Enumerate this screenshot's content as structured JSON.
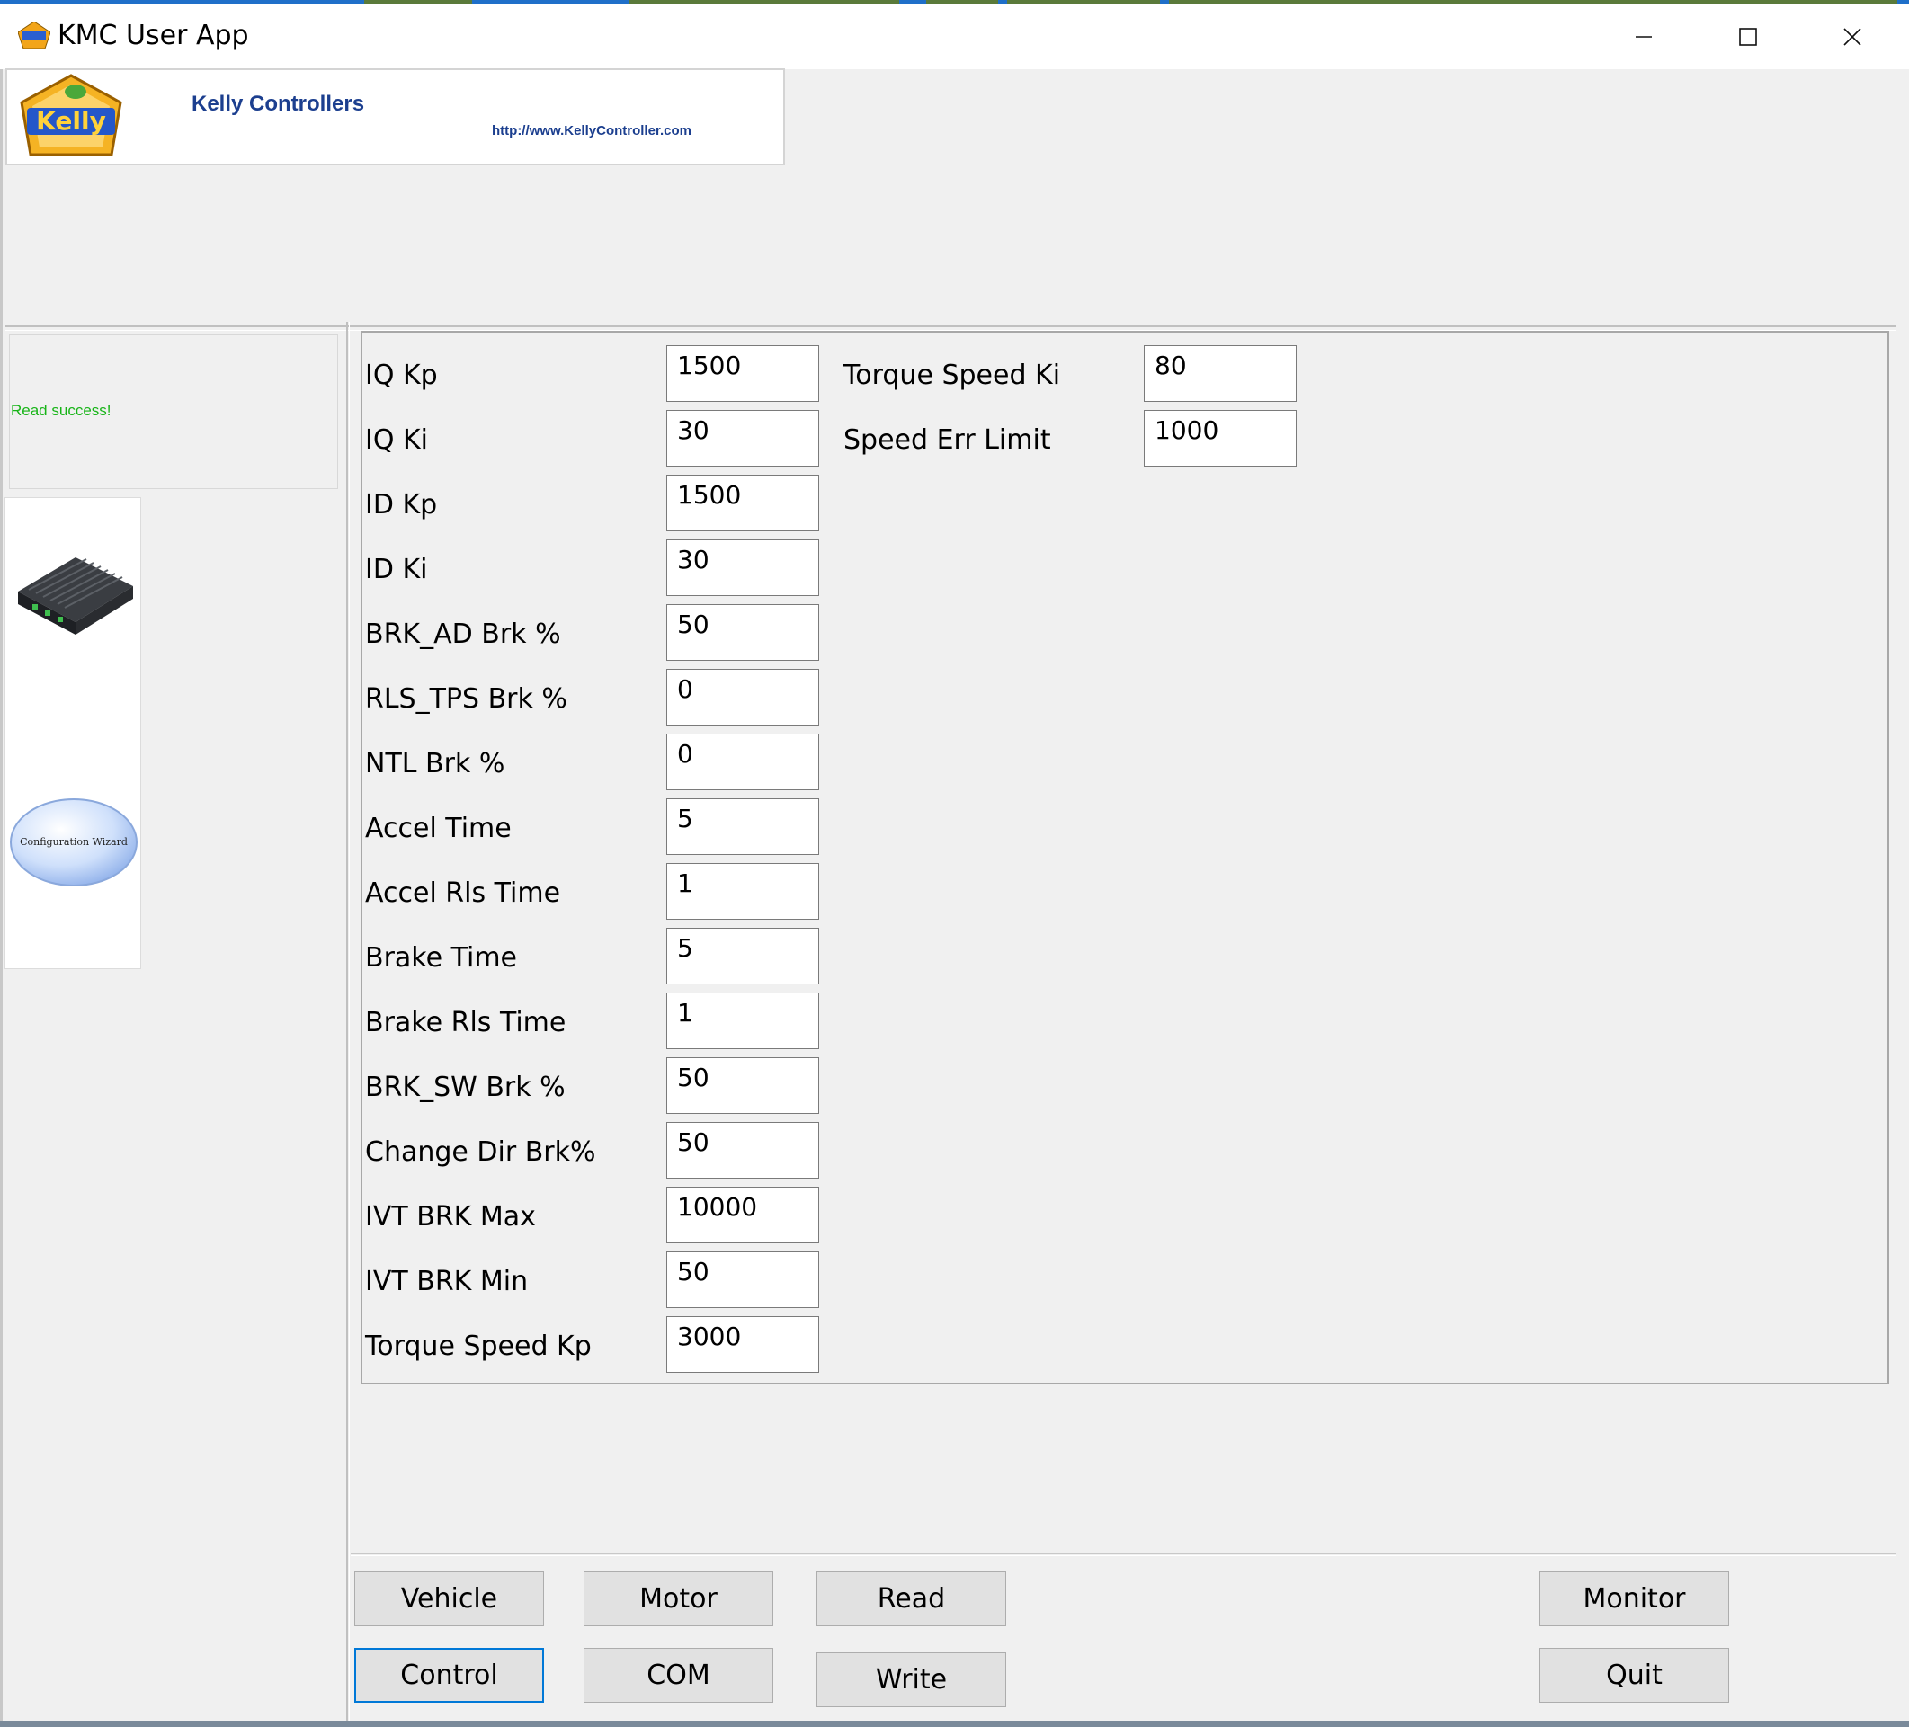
{
  "window": {
    "title": "KMC User App",
    "controls": {
      "minimize": "—",
      "maximize": "☐",
      "close": "✕"
    }
  },
  "banner": {
    "brand": "Kelly Controllers",
    "url": "http://www.KellyController.com",
    "logo_text": "Kelly"
  },
  "status": {
    "message": "Read success!",
    "color": "#18b418"
  },
  "wizard": {
    "label": "Configuration Wizard"
  },
  "params_left": [
    {
      "label": "IQ Kp",
      "value": "1500"
    },
    {
      "label": "IQ Ki",
      "value": "30"
    },
    {
      "label": "ID Kp",
      "value": "1500"
    },
    {
      "label": "ID Ki",
      "value": "30"
    },
    {
      "label": "BRK_AD Brk %",
      "value": "50"
    },
    {
      "label": "RLS_TPS Brk %",
      "value": "0"
    },
    {
      "label": "NTL Brk %",
      "value": "0"
    },
    {
      "label": "Accel Time",
      "value": "5"
    },
    {
      "label": "Accel Rls Time",
      "value": "1"
    },
    {
      "label": "Brake Time",
      "value": "5"
    },
    {
      "label": "Brake Rls Time",
      "value": "1"
    },
    {
      "label": "BRK_SW Brk %",
      "value": "50"
    },
    {
      "label": "Change Dir Brk%",
      "value": "50"
    },
    {
      "label": "IVT BRK Max",
      "value": "10000"
    },
    {
      "label": "IVT BRK Min",
      "value": "50"
    },
    {
      "label": "Torque Speed Kp",
      "value": "3000"
    }
  ],
  "params_right": [
    {
      "label": "Torque Speed Ki",
      "value": "80"
    },
    {
      "label": "Speed Err Limit",
      "value": "1000"
    }
  ],
  "buttons": {
    "vehicle": "Vehicle",
    "motor": "Motor",
    "read": "Read",
    "monitor": "Monitor",
    "control": "Control",
    "com": "COM",
    "write": "Write",
    "quit": "Quit"
  },
  "colors": {
    "brand_blue": "#1c3f8f",
    "focus_border": "#0078d7"
  }
}
